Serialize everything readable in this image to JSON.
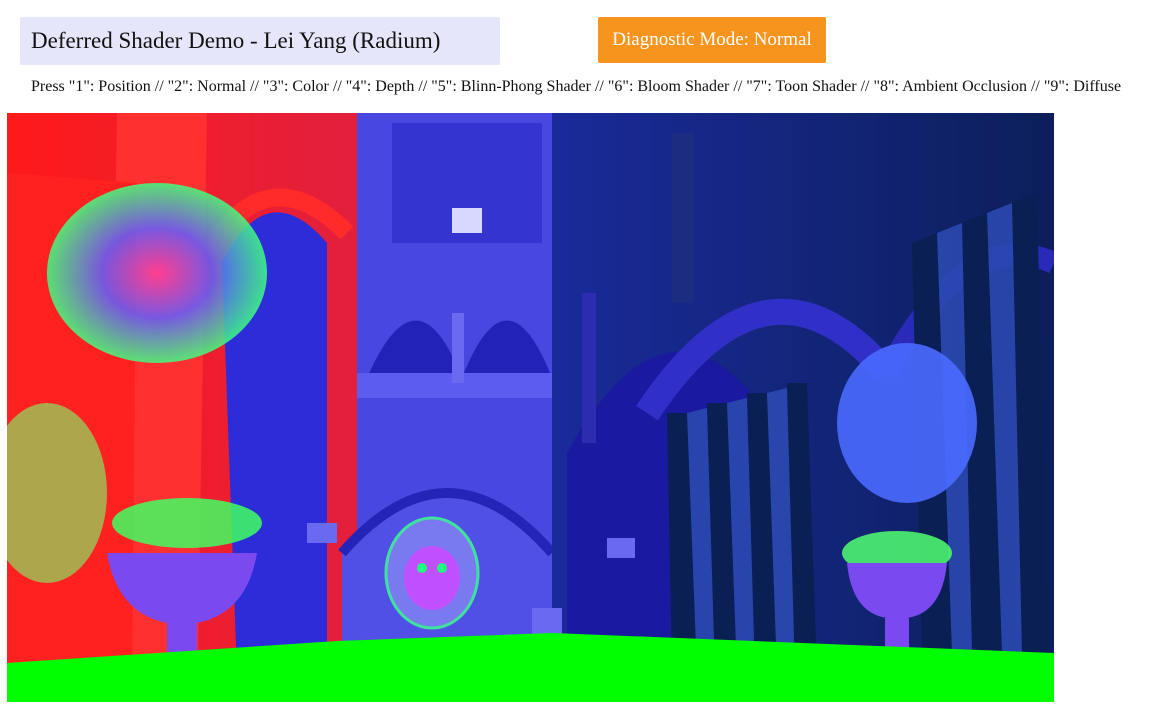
{
  "header": {
    "title": "Deferred Shader Demo - Lei Yang (Radium)",
    "mode_button_label": "Diagnostic Mode: Normal"
  },
  "instructions": {
    "text": "Press \"1\": Position // \"2\": Normal // \"3\": Color // \"4\": Depth // \"5\": Blinn-Phong Shader // \"6\": Bloom Shader // \"7\": Toon Shader // \"8\": Ambient Occlusion // \"9\": Diffuse"
  },
  "viewport": {
    "scene": "normal-buffer-render",
    "colors": {
      "wall_blue": "#3a3adc",
      "deep_blue": "#1818a8",
      "red": "#ff2020",
      "green_floor": "#00ff00",
      "dark_teal": "#0e2f66"
    }
  }
}
